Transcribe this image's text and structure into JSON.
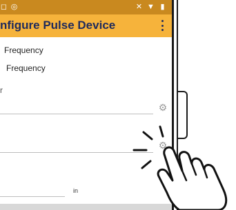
{
  "status_bar": {
    "left_icons": [
      "notification-icon",
      "signal-icon"
    ],
    "right_icons": [
      "mute-icon",
      "wifi-icon",
      "battery-icon"
    ]
  },
  "app_bar": {
    "title": "nfigure Pulse Device"
  },
  "options": {
    "first_label": "Frequency",
    "second_label": "Frequency"
  },
  "section": {
    "label": "r"
  },
  "fields": {
    "unit_label": "in"
  },
  "colors": {
    "status_bar": "#c9891f",
    "app_bar": "#f6b33b",
    "title_text": "#1f2b5c"
  }
}
